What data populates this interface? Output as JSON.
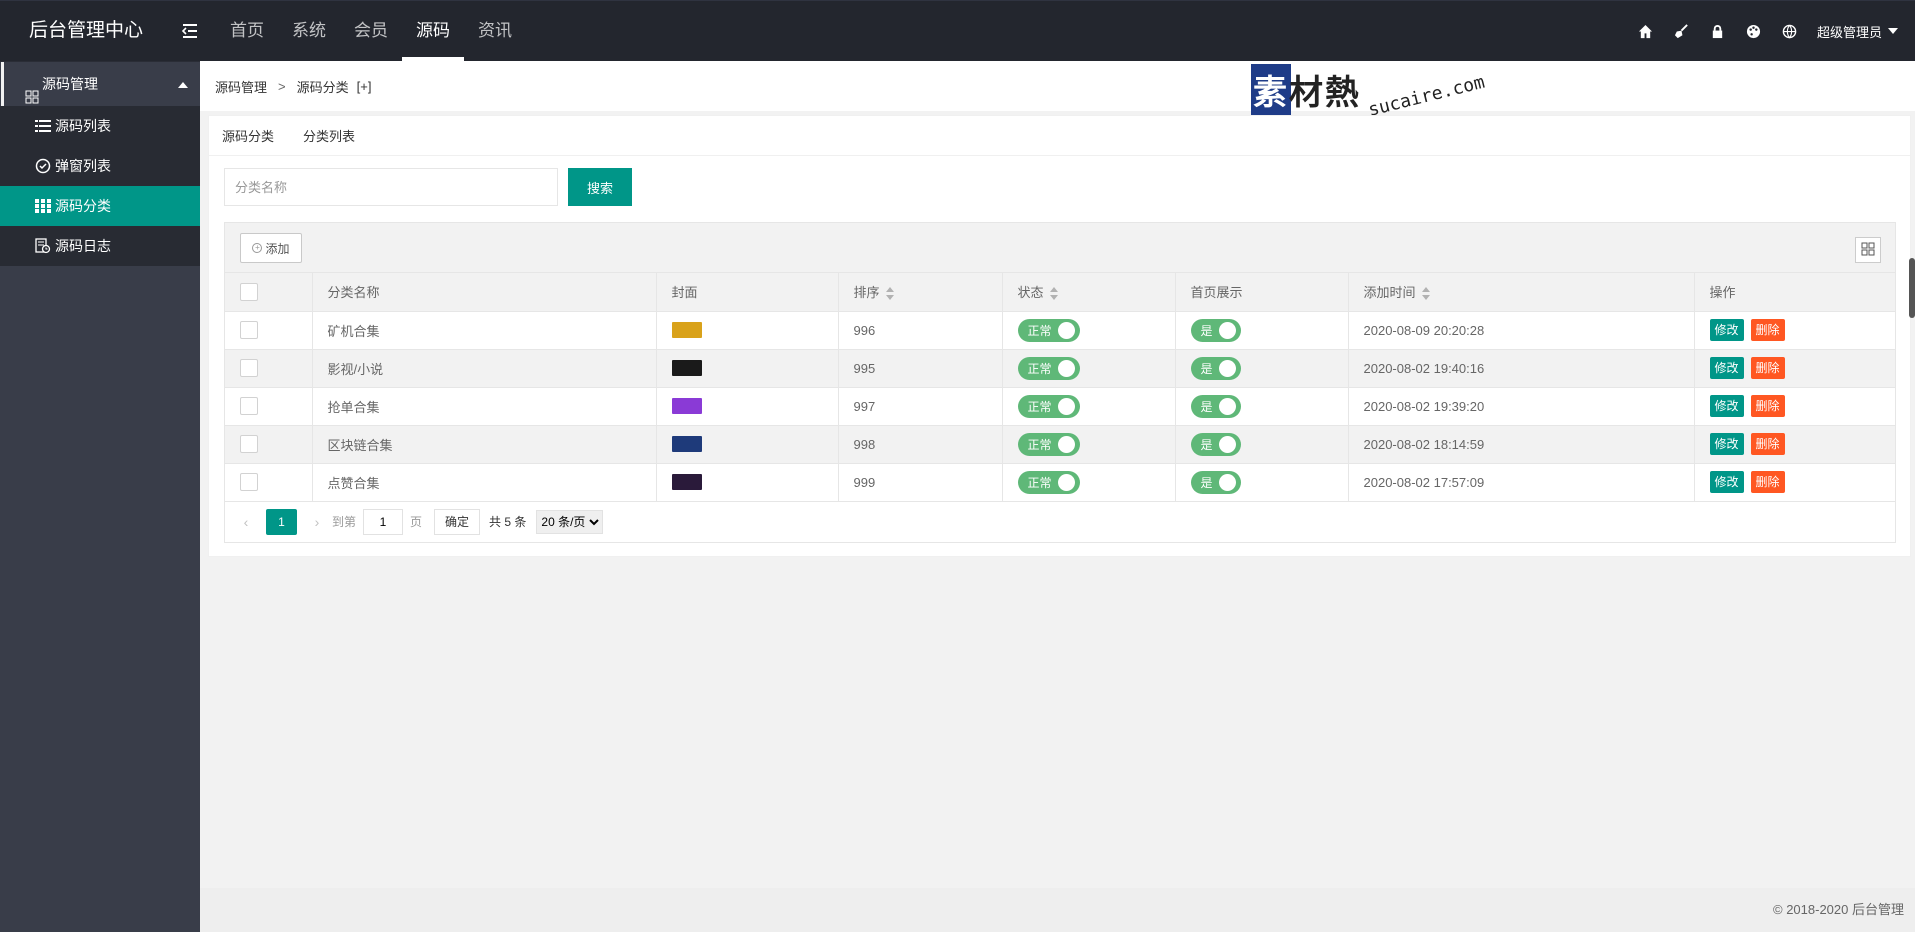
{
  "app": {
    "title": "后台管理中心"
  },
  "top_nav": [
    {
      "label": "首页",
      "active": false
    },
    {
      "label": "系统",
      "active": false
    },
    {
      "label": "会员",
      "active": false
    },
    {
      "label": "源码",
      "active": true
    },
    {
      "label": "资讯",
      "active": false
    }
  ],
  "header_right": {
    "icons": [
      "home-icon",
      "broom-icon",
      "lock-icon",
      "palette-icon",
      "globe-icon"
    ],
    "user": "超级管理员"
  },
  "sidebar": {
    "group_label": "源码管理",
    "items": [
      {
        "label": "源码列表",
        "icon": "list-icon",
        "active": false
      },
      {
        "label": "弹窗列表",
        "icon": "check-circle-icon",
        "active": false
      },
      {
        "label": "源码分类",
        "icon": "grid-icon",
        "active": true
      },
      {
        "label": "源码日志",
        "icon": "log-icon",
        "active": false
      }
    ]
  },
  "breadcrumb": {
    "root": "源码管理",
    "sep": ">",
    "current": "源码分类",
    "extra": "[+]"
  },
  "watermark": {
    "main": "素材熱",
    "sub": "sucaire.com"
  },
  "tabs": [
    "源码分类",
    "分类列表"
  ],
  "search": {
    "placeholder": "分类名称",
    "button": "搜索"
  },
  "toolbar": {
    "add_label": "添加"
  },
  "table": {
    "headers": {
      "name": "分类名称",
      "cover": "封面",
      "sort": "排序",
      "status": "状态",
      "home": "首页展示",
      "time": "添加时间",
      "ops": "操作"
    },
    "rows": [
      {
        "name": "矿机合集",
        "cover_color": "#d9a21a",
        "sort": "996",
        "status": "正常",
        "home": "是",
        "time": "2020-08-09 20:20:28"
      },
      {
        "name": "影视/小说",
        "cover_color": "#1a1a1a",
        "sort": "995",
        "status": "正常",
        "home": "是",
        "time": "2020-08-02 19:40:16"
      },
      {
        "name": "抢单合集",
        "cover_color": "#8a3ad6",
        "sort": "997",
        "status": "正常",
        "home": "是",
        "time": "2020-08-02 19:39:20"
      },
      {
        "name": "区块链合集",
        "cover_color": "#1e3a7a",
        "sort": "998",
        "status": "正常",
        "home": "是",
        "time": "2020-08-02 18:14:59"
      },
      {
        "name": "点赞合集",
        "cover_color": "#2a1a3a",
        "sort": "999",
        "status": "正常",
        "home": "是",
        "time": "2020-08-02 17:57:09"
      }
    ],
    "edit_label": "修改",
    "delete_label": "删除"
  },
  "pager": {
    "current": "1",
    "goto_label": "到第",
    "goto_value": "1",
    "page_unit": "页",
    "ok": "确定",
    "total": "共 5 条",
    "per_page": "20 条/页"
  },
  "footer": "© 2018-2020 后台管理",
  "colors": {
    "header": "#23262e",
    "sidebar": "#393d49",
    "accent": "#009688",
    "danger": "#ff5722",
    "switch_on": "#5fb878"
  }
}
